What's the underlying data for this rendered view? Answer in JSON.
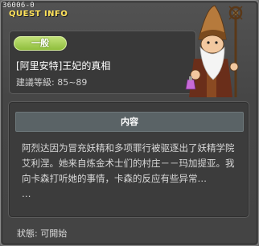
{
  "window": {
    "id_label": "36006-0",
    "title": "QUEST INFO"
  },
  "quest": {
    "category_badge": "一般",
    "name": "[阿里安特]王妃的真相",
    "level_range": "建議等級: 85~89"
  },
  "content": {
    "header": "内容",
    "description": "阿烈达因为冒充妖精和多项罪行被驱逐出了妖精学院艾利涅。她来自炼金术士们的村庄－－玛加提亚。我向卡森打听她的事情，卡森的反应有些异常…",
    "ellipsis": "…"
  },
  "status": {
    "text": "狀態: 可開始"
  },
  "npc": {
    "icon": "wizard-npc-portrait"
  },
  "colors": {
    "title": "#ffe25a",
    "badge": "#a5d150",
    "panel": "#3c3c3c",
    "header": "#5a6366"
  }
}
